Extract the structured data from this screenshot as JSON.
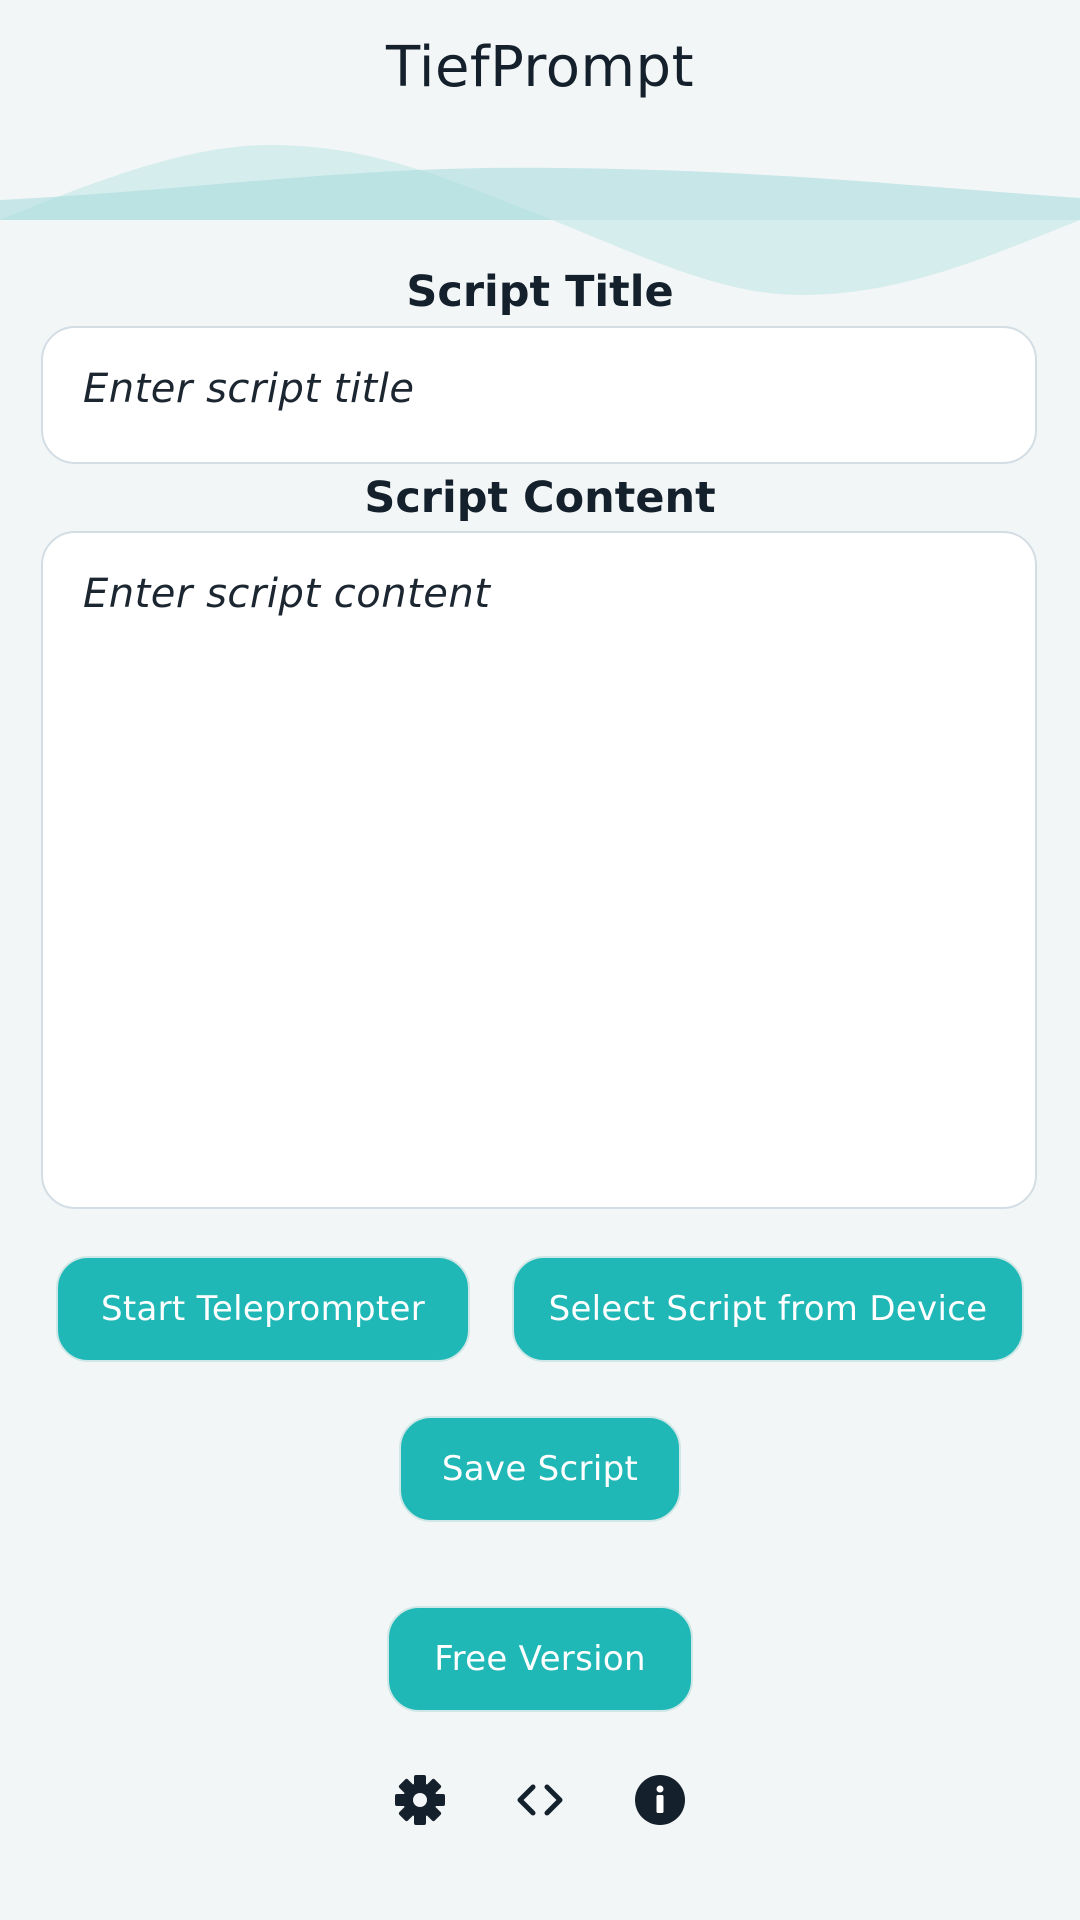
{
  "app": {
    "title": "TiefPrompt"
  },
  "form": {
    "script_title_label": "Script Title",
    "script_title_placeholder": "Enter script title",
    "script_title_value": "",
    "script_content_label": "Script Content",
    "script_content_placeholder": "Enter script content",
    "script_content_value": ""
  },
  "actions": {
    "start_label": "Start Teleprompter",
    "select_label": "Select Script from Device",
    "save_label": "Save Script",
    "version_label": "Free Version"
  },
  "footer": {
    "icons": [
      "gear-icon",
      "code-icon",
      "info-icon"
    ]
  },
  "colors": {
    "accent": "#20b8b6",
    "background": "#f3f6f7",
    "wave": "#b9e3e4",
    "text": "#14202b"
  }
}
